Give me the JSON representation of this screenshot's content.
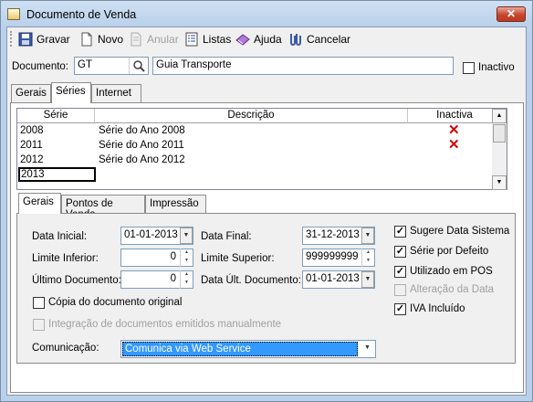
{
  "window": {
    "title": "Documento de Venda",
    "close_glyph": "✕"
  },
  "toolbar": {
    "gravar": "Gravar",
    "novo": "Novo",
    "anular": "Anular",
    "listas": "Listas",
    "ajuda": "Ajuda",
    "cancelar": "Cancelar"
  },
  "documento": {
    "label": "Documento:",
    "code": "GT",
    "description": "Guia Transporte",
    "inactivo_label": "Inactivo",
    "inactivo_checked": false
  },
  "tabs": [
    "Gerais",
    "Séries",
    "Internet"
  ],
  "series_grid": {
    "headers": [
      "Série",
      "Descrição",
      "Inactiva"
    ],
    "rows": [
      {
        "serie": "2008",
        "descricao": "Série do Ano 2008",
        "inactiva": true
      },
      {
        "serie": "2011",
        "descricao": "Série do Ano 2011",
        "inactiva": true
      },
      {
        "serie": "2012",
        "descricao": "Série do Ano 2012",
        "inactiva": false
      },
      {
        "serie": "2013",
        "descricao": "",
        "inactiva": false
      }
    ]
  },
  "subtabs": [
    "Gerais",
    "Pontos de Venda",
    "Impressão"
  ],
  "gerais": {
    "data_inicial_label": "Data Inicial:",
    "data_inicial": "01-01-2013",
    "data_final_label": "Data Final:",
    "data_final": "31-12-2013",
    "limite_inferior_label": "Limite Inferior:",
    "limite_inferior": "0",
    "limite_superior_label": "Limite Superior:",
    "limite_superior": "999999999",
    "ultimo_doc_label": "Último Documento:",
    "ultimo_doc": "0",
    "data_ult_doc_label": "Data Últ. Documento:",
    "data_ult_doc": "01-01-2013",
    "copia_label": "Cópia do documento original",
    "integracao_label": "Integração de documentos emitidos manualmente",
    "comunicacao_label": "Comunicação:",
    "comunicacao_value": "Comunica via Web Service"
  },
  "right_checks": [
    {
      "label": "Sugere Data Sistema",
      "checked": true,
      "enabled": true
    },
    {
      "label": "Série por Defeito",
      "checked": true,
      "enabled": true
    },
    {
      "label": "Utilizado em POS",
      "checked": true,
      "enabled": true
    },
    {
      "label": "Alteração da Data",
      "checked": false,
      "enabled": false
    },
    {
      "label": "IVA Incluído",
      "checked": true,
      "enabled": true
    }
  ],
  "colors": {
    "selection": "#3399ff",
    "disabled_text": "#a0a0a0",
    "red_x": "#d40000"
  }
}
